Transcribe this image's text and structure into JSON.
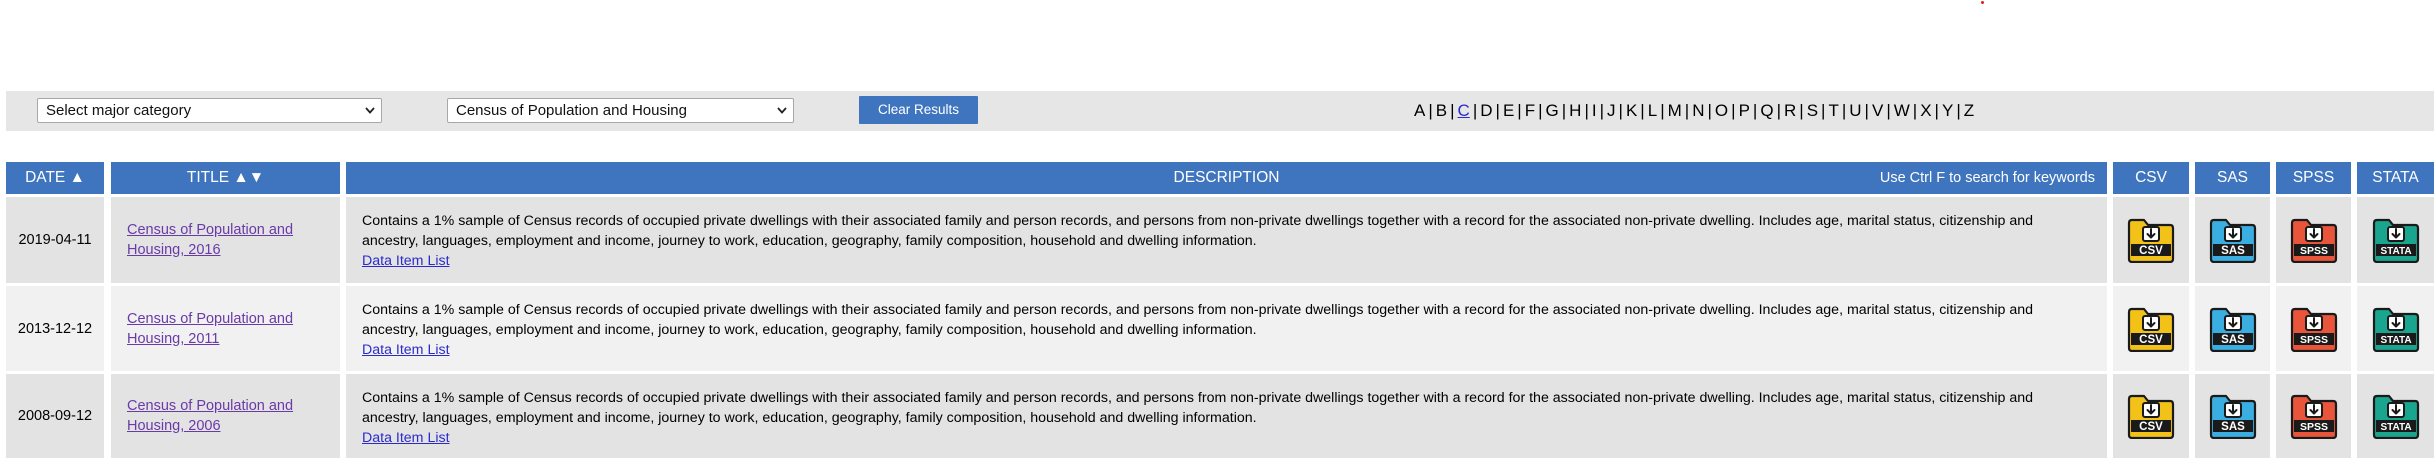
{
  "filters": {
    "category_select": "Select major category",
    "dataset_select": "Census of Population and Housing",
    "clear_button": "Clear Results"
  },
  "alphabet": [
    "A",
    "B",
    "C",
    "D",
    "E",
    "F",
    "G",
    "H",
    "I",
    "J",
    "K",
    "L",
    "M",
    "N",
    "O",
    "P",
    "Q",
    "R",
    "S",
    "T",
    "U",
    "V",
    "W",
    "X",
    "Y",
    "Z"
  ],
  "alphabet_active": "C",
  "table": {
    "headers": {
      "date": "DATE ▲",
      "title": "TITLE ▲▼",
      "description": "DESCRIPTION",
      "search_hint": "Use Ctrl F to search for keywords",
      "csv": "CSV",
      "sas": "SAS",
      "spss": "SPSS",
      "stata": "STATA"
    },
    "rows": [
      {
        "date": "2019-04-11",
        "title": "Census of Population and Housing, 2016",
        "description": "Contains a 1% sample of Census records of occupied private dwellings with their associated family and person records, and persons from non-private dwellings together with a record for the associated non-private dwelling. Includes age, marital status, citizenship and ancestry, languages, employment and income, journey to work, education, geography, family composition, household and dwelling information.",
        "link": "Data Item List"
      },
      {
        "date": "2013-12-12",
        "title": "Census of Population and Housing, 2011",
        "description": "Contains a 1% sample of Census records of occupied private dwellings with their associated family and person records, and persons from non-private dwellings together with a record for the associated non-private dwelling. Includes age, marital status, citizenship and ancestry, languages, employment and income, journey to work, education, geography, family composition, household and dwelling information.",
        "link": "Data Item List"
      },
      {
        "date": "2008-09-12",
        "title": "Census of Population and Housing, 2006",
        "description": "Contains a 1% sample of Census records of occupied private dwellings with their associated family and person records, and persons from non-private dwellings together with a record for the associated non-private dwelling. Includes age, marital status, citizenship and ancestry, languages, employment and income, journey to work, education, geography, family composition, household and dwelling information.",
        "link": "Data Item List"
      }
    ]
  },
  "icons": {
    "csv": {
      "label": "CSV",
      "color": "#f2c218",
      "icon": "csv-file-download-icon"
    },
    "sas": {
      "label": "SAS",
      "color": "#3aaee0",
      "icon": "sas-file-download-icon"
    },
    "spss": {
      "label": "SPSS",
      "color": "#e8553a",
      "icon": "spss-file-download-icon"
    },
    "stata": {
      "label": "STATA",
      "color": "#1aa58f",
      "icon": "stata-file-download-icon"
    }
  },
  "colors": {
    "header_blue": "#3f75be",
    "title_link": "#6a3aa8",
    "data_link": "#2b2bcc"
  }
}
